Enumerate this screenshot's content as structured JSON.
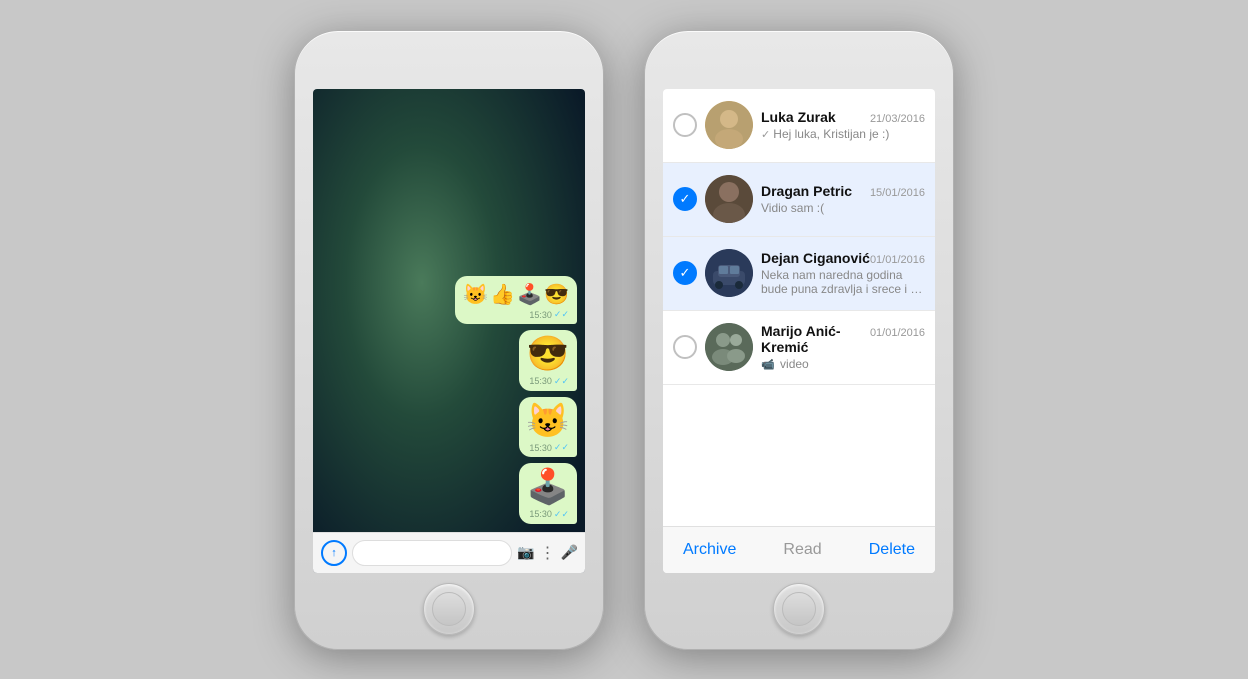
{
  "phone1": {
    "messages": [
      {
        "emojis": [
          "😺",
          "👍",
          "🕹️",
          "😎"
        ],
        "time": "15:30",
        "read": true,
        "type": "multi-emoji-top"
      },
      {
        "emoji": "😎",
        "time": "15:30",
        "read": true
      },
      {
        "emoji": "😺",
        "time": "15:30",
        "read": true
      },
      {
        "emoji": "🕹️",
        "time": "15:30",
        "read": true
      }
    ],
    "input": {
      "placeholder": ""
    },
    "icons": {
      "send": "↑",
      "camera": "📷",
      "more": "⋮",
      "mic": "🎤"
    }
  },
  "phone2": {
    "conversations": [
      {
        "id": "luka",
        "name": "Luka Zurak",
        "date": "21/03/2016",
        "preview": "✓ Hej luka, Kristijan je :)",
        "selected": false,
        "avatarEmoji": "👨"
      },
      {
        "id": "dragan",
        "name": "Dragan Petric",
        "date": "15/01/2016",
        "preview": "Vidio sam :(",
        "selected": true,
        "avatarEmoji": "👨"
      },
      {
        "id": "dejan",
        "name": "Dejan Ciganović",
        "date": "01/01/2016",
        "preview": "Neka nam naredna godina bude puna zdravlja i srece i da se uvijek...",
        "selected": true,
        "avatarEmoji": "🚗"
      },
      {
        "id": "marijo",
        "name": "Marijo Anić-Kremić",
        "date": "01/01/2016",
        "preview": "video",
        "selected": false,
        "avatarEmoji": "👥"
      }
    ],
    "actions": {
      "archive": "Archive",
      "read": "Read",
      "delete": "Delete"
    }
  }
}
